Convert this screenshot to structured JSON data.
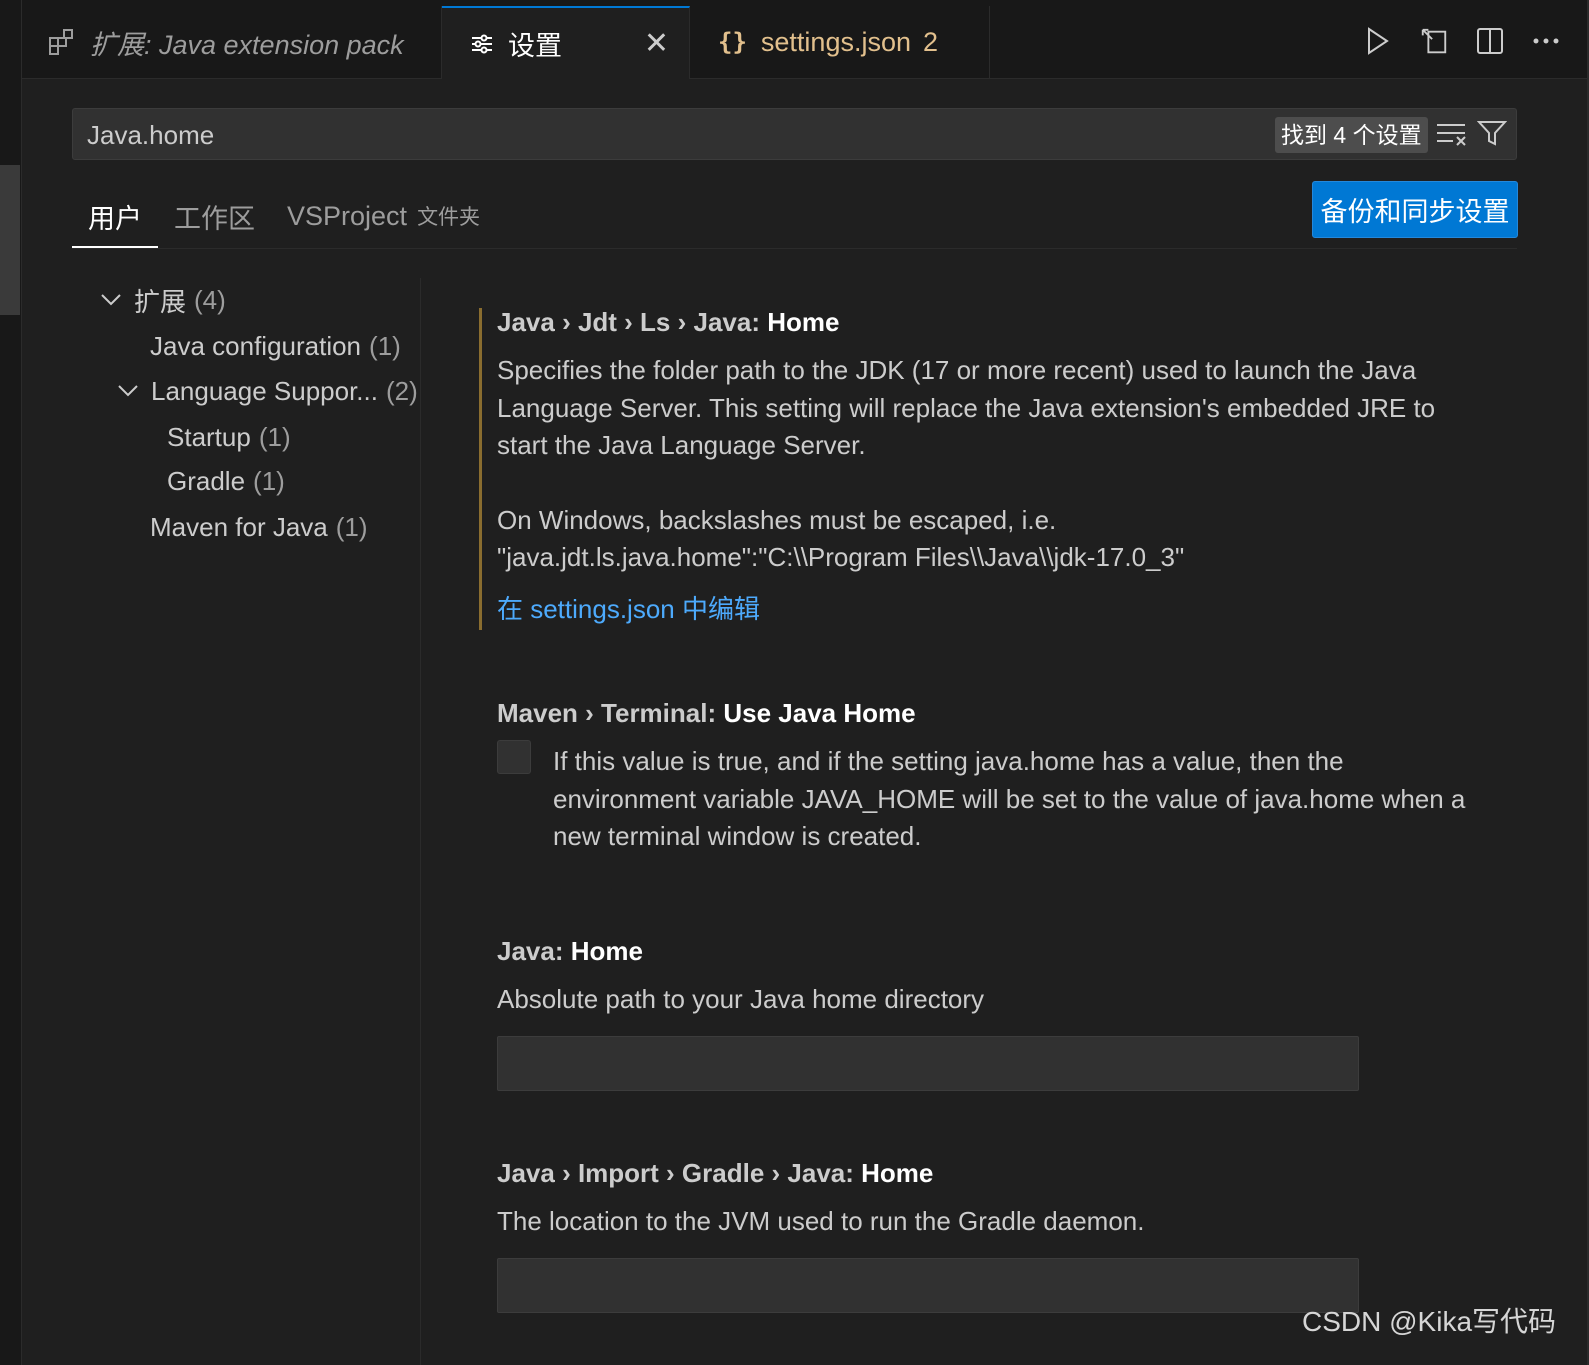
{
  "tabs": [
    {
      "label": "扩展: Java extension pack",
      "icon": "extensions-icon"
    },
    {
      "label": "设置",
      "icon": "settings-icon",
      "close": "✕"
    },
    {
      "label": "settings.json",
      "icon": "json-braces-icon",
      "badge": "2"
    }
  ],
  "actions": [
    "run-icon",
    "open-settings-json-icon",
    "split-editor-icon",
    "more-actions-icon"
  ],
  "search": {
    "value": "Java.home",
    "result": "找到 4 个设置"
  },
  "scopes": {
    "user": "用户",
    "workspace": "工作区",
    "folder": "VSProject",
    "folder_suffix": "文件夹"
  },
  "sync_button": "备份和同步设置",
  "toc": [
    {
      "label": "扩展",
      "count": "(4)",
      "expanded": true
    },
    {
      "label": "Java configuration",
      "count": "(1)"
    },
    {
      "label": "Language Suppor...",
      "count": "(2)",
      "expanded": true
    },
    {
      "label": "Startup",
      "count": "(1)"
    },
    {
      "label": "Gradle",
      "count": "(1)"
    },
    {
      "label": "Maven for Java",
      "count": "(1)"
    }
  ],
  "settings": [
    {
      "prefix": "Java › Jdt › Ls › Java: ",
      "key": "Home",
      "desc1": "Specifies the folder path to the JDK (17 or more recent) used to launch the Java Language Server. This setting will replace the Java extension's embedded JRE to start the Java Language Server.",
      "desc2a": "On Windows, backslashes must be escaped, i.e.",
      "desc2b": "\"java.jdt.ls.java.home\":\"C:\\\\Program Files\\\\Java\\\\jdk-17.0_3\"",
      "link": "在 settings.json 中编辑"
    },
    {
      "prefix": "Maven › Terminal: ",
      "key": "Use Java Home",
      "desc": "If this value is true, and if the setting java.home has a value, then the environment variable JAVA_HOME will be set to the value of java.home when a new terminal window is created.",
      "checked": false
    },
    {
      "prefix": "Java: ",
      "key": "Home",
      "desc": "Absolute path to your Java home directory",
      "value": ""
    },
    {
      "prefix": "Java › Import › Gradle › Java: ",
      "key": "Home",
      "desc": "The location to the JVM used to run the Gradle daemon.",
      "value": ""
    }
  ],
  "watermark": "CSDN @Kika写代码",
  "colors": {
    "accent": "#0078d4",
    "link": "#4daafc",
    "modified": "#8a6d2f",
    "json_tab": "#e2c08d"
  }
}
